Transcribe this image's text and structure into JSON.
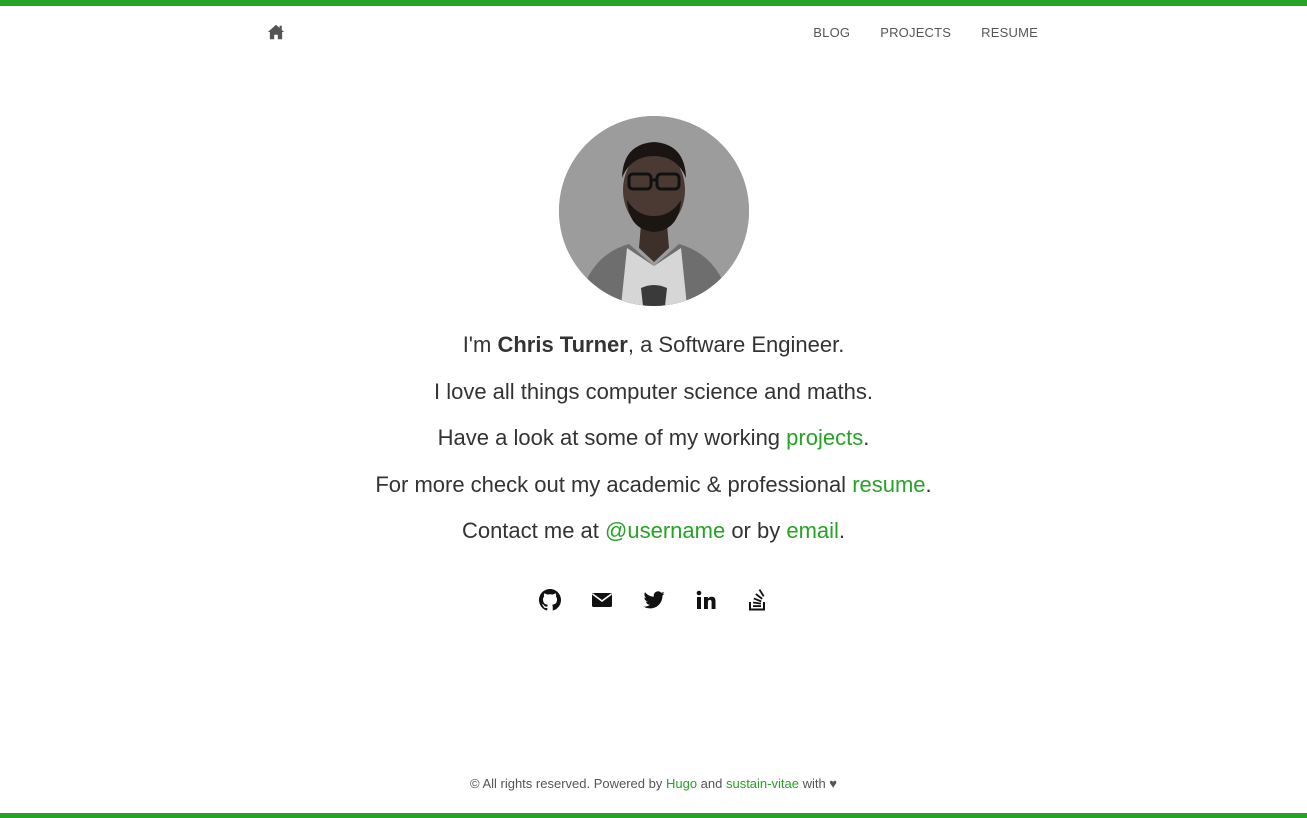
{
  "theme": {
    "accent": "#26a325",
    "text": "#333333",
    "muted": "#555555"
  },
  "nav": {
    "home_icon": "home-icon",
    "items": [
      {
        "label": "BLOG"
      },
      {
        "label": "PROJECTS"
      },
      {
        "label": "RESUME"
      }
    ]
  },
  "hero": {
    "avatar_alt": "avatar",
    "line1": {
      "prefix": "I'm ",
      "name": "Chris Turner",
      "suffix": ", a Software Engineer."
    },
    "line2": "I love all things computer science and maths.",
    "line3": {
      "prefix": "Have a look at some of my working ",
      "link": "projects",
      "suffix": "."
    },
    "line4": {
      "prefix": "For more check out my academic & professional ",
      "link": "resume",
      "suffix": "."
    },
    "line5": {
      "prefix": "Contact me at ",
      "link1": "@username",
      "middle": " or by ",
      "link2": "email",
      "suffix": "."
    }
  },
  "social": [
    {
      "name": "github-icon"
    },
    {
      "name": "envelope-icon"
    },
    {
      "name": "twitter-icon"
    },
    {
      "name": "linkedin-icon"
    },
    {
      "name": "stackoverflow-icon"
    }
  ],
  "footer": {
    "prefix": "© All rights reserved. Powered by ",
    "link1": "Hugo",
    "middle": " and ",
    "link2": "sustain-vitae",
    "suffix": " with ♥"
  }
}
